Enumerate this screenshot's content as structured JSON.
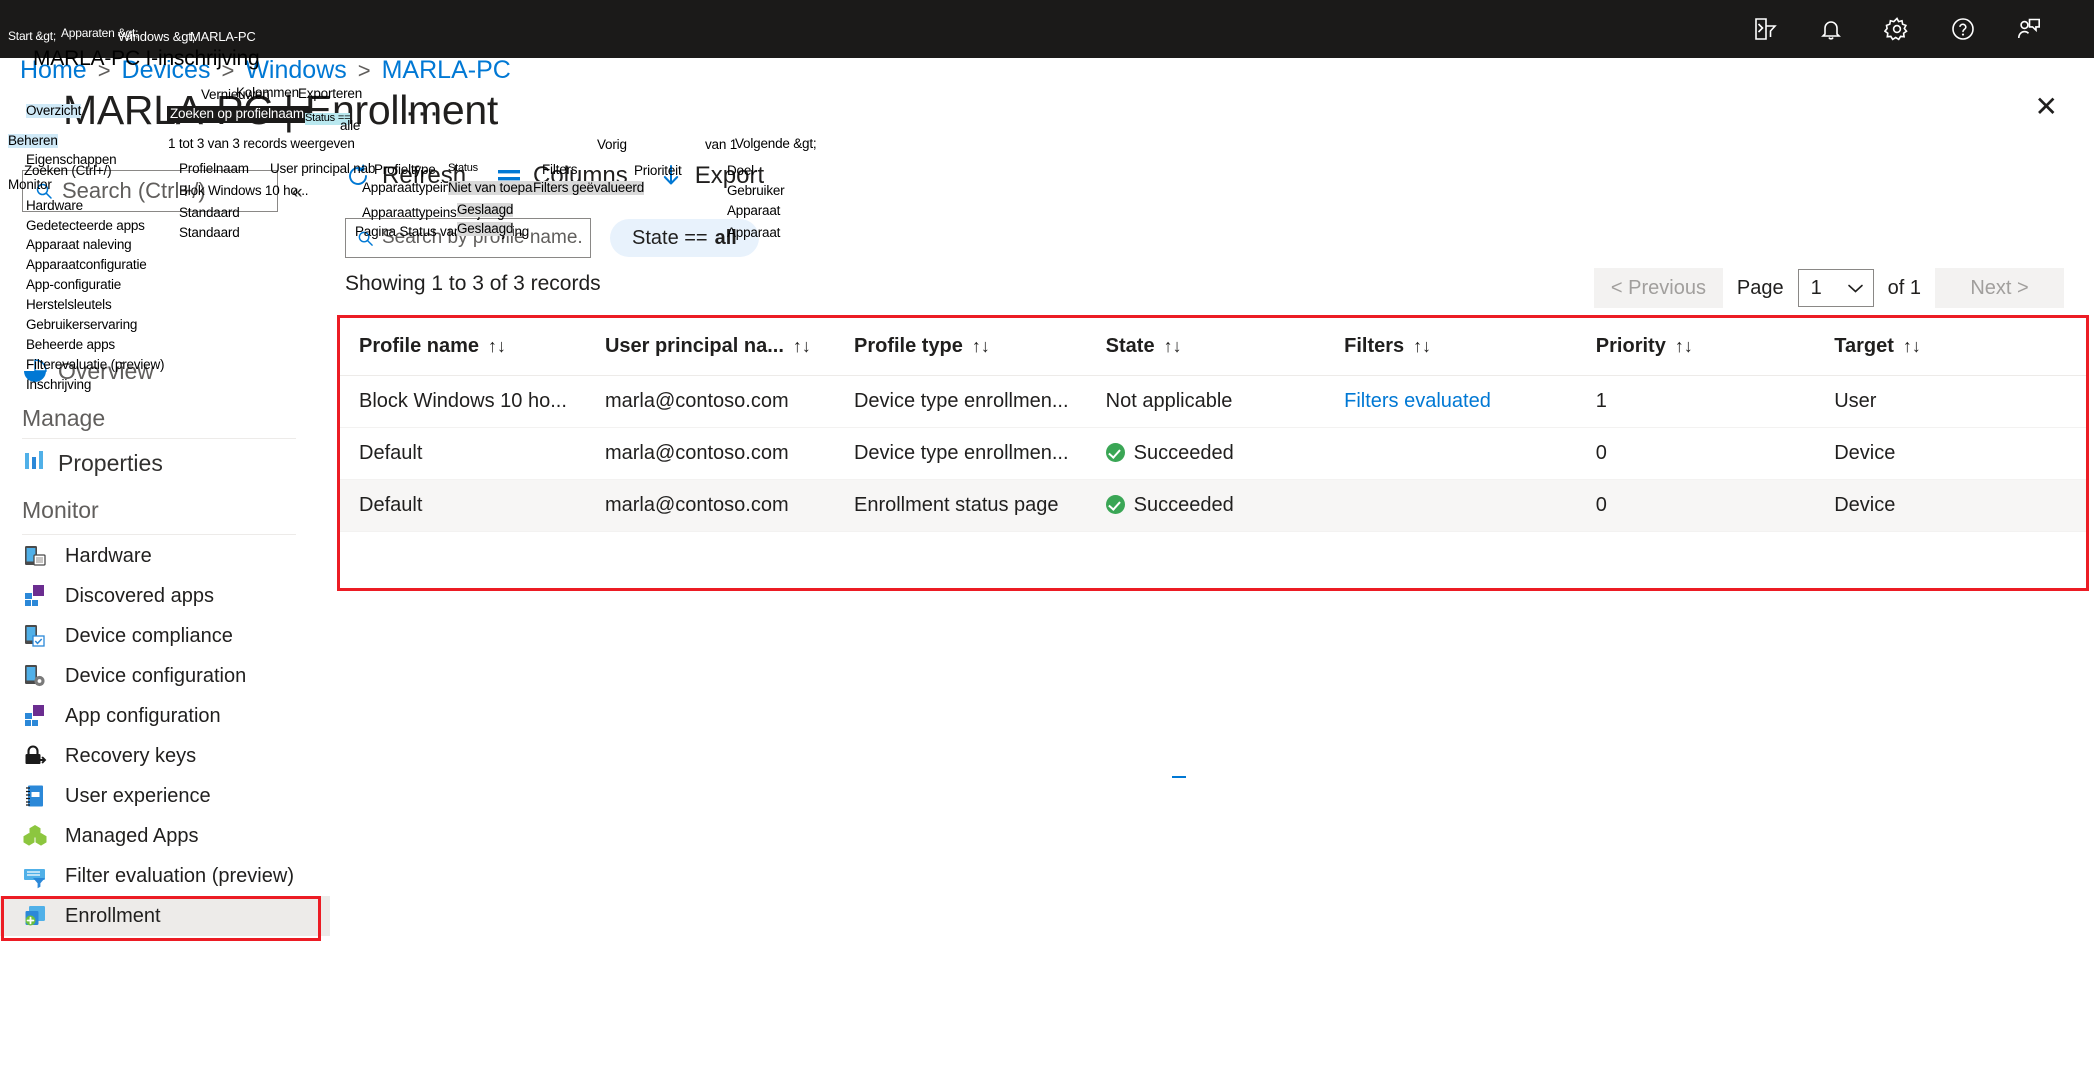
{
  "topbar": {
    "icons": [
      {
        "name": "cloud-shell-icon",
        "title": "Cloud Shell"
      },
      {
        "name": "notifications-bell-icon",
        "title": "Notifications"
      },
      {
        "name": "settings-gear-icon",
        "title": "Settings"
      },
      {
        "name": "help-question-icon",
        "title": "Help"
      },
      {
        "name": "feedback-person-icon",
        "title": "Feedback"
      }
    ]
  },
  "breadcrumb": {
    "items": [
      "Home",
      "Devices",
      "Windows",
      "MARLA-PC"
    ],
    "separator": ">"
  },
  "header": {
    "title": "MARLA-PC | Enrollment",
    "ellipsis": "···",
    "close": "✕"
  },
  "sidebar": {
    "search_placeholder": "Search (Ctrl+/)",
    "collapse_glyph": "«",
    "section_overview": "Overview",
    "section_manage": "Manage",
    "section_monitor": "Monitor",
    "properties_label": "Properties",
    "items": [
      {
        "label": "Hardware",
        "icon": "device-hardware-icon"
      },
      {
        "label": "Discovered apps",
        "icon": "apps-grid-icon"
      },
      {
        "label": "Device compliance",
        "icon": "device-check-icon"
      },
      {
        "label": "Device configuration",
        "icon": "device-gear-icon"
      },
      {
        "label": "App configuration",
        "icon": "apps-grid-icon"
      },
      {
        "label": "Recovery keys",
        "icon": "lock-key-icon"
      },
      {
        "label": "User experience",
        "icon": "notebook-icon"
      },
      {
        "label": "Managed Apps",
        "icon": "cubes-icon"
      },
      {
        "label": "Filter evaluation (preview)",
        "icon": "filter-list-icon"
      },
      {
        "label": "Enrollment",
        "icon": "device-add-icon",
        "selected": true
      }
    ]
  },
  "toolbar": {
    "refresh_label": "Refresh",
    "columns_label": "Columns",
    "export_label": "Export"
  },
  "filters": {
    "search_placeholder": "Search by profile name.",
    "state_pill_key": "State  ==",
    "state_pill_value": "all"
  },
  "records_text": "Showing 1 to 3 of 3 records",
  "pagination": {
    "previous_label": "< Previous",
    "page_label": "Page",
    "page_value": "1",
    "of_label": "of 1",
    "next_label": "Next >",
    "chevron": "⌄"
  },
  "table": {
    "columns": [
      {
        "key": "profile_name",
        "label": "Profile name"
      },
      {
        "key": "user_principal_name",
        "label": "User principal na..."
      },
      {
        "key": "profile_type",
        "label": "Profile type"
      },
      {
        "key": "state",
        "label": "State"
      },
      {
        "key": "filters",
        "label": "Filters"
      },
      {
        "key": "priority",
        "label": "Priority"
      },
      {
        "key": "target",
        "label": "Target"
      }
    ],
    "sort_glyph": "↑↓",
    "rows": [
      {
        "profile_name": "Block Windows 10 ho...",
        "user_principal_name": "marla@contoso.com",
        "profile_type": "Device type enrollmen...",
        "state": "Not applicable",
        "state_ok": false,
        "filters": "Filters evaluated",
        "filters_is_link": true,
        "priority": "1",
        "target": "User"
      },
      {
        "profile_name": "Default",
        "user_principal_name": "marla@contoso.com",
        "profile_type": "Device type enrollmen...",
        "state": "Succeeded",
        "state_ok": true,
        "filters": "",
        "filters_is_link": false,
        "priority": "0",
        "target": "Device"
      },
      {
        "profile_name": "Default",
        "user_principal_name": "marla@contoso.com",
        "profile_type": "Enrollment status page",
        "state": "Succeeded",
        "state_ok": true,
        "filters": "",
        "filters_is_link": false,
        "priority": "0",
        "target": "Device"
      }
    ]
  },
  "annotations": {
    "breadcrumb_start": "Start &gt;",
    "breadcrumb_devices": "Apparaten &gt;",
    "breadcrumb_windows": "Windows &gt;",
    "breadcrumb_device": "MARLA-PC",
    "page_title_nl": "MARLA-PC I-inschrijving",
    "nav_search_nl": "Zoeken (Ctrl+/)",
    "overview_nl": "Overzicht",
    "manage_nl": "Beheren",
    "properties_nl": "Eigenschappen",
    "monitor_nl": "Monitor",
    "hardware_nl": "Hardware",
    "discovered_apps_nl": "Gedetecteerde apps",
    "device_compliance_nl": "Apparaat naleving",
    "device_configuration_nl": "Apparaatconfiguratie",
    "app_configuration_nl": "App-configuratie",
    "recovery_keys_nl": "Herstelsleutels",
    "user_experience_nl": "Gebruikerservaring",
    "managed_apps_nl": "Beheerde apps",
    "filter_evaluation_nl": "Filterevaluatie (preview)",
    "enrollment_nl": "Inschrijving",
    "refresh_nl": "Vernieuwen",
    "columns_nl": "Kolommen",
    "export_nl": "Exporteren",
    "search_profile_nl": "Zoeken op profielnaam.",
    "state_key_nl": "Status ==",
    "state_value_nl": "alle",
    "records_nl": "1 tot 3 van 3 records weergeven",
    "col_profile_name_nl": "Profielnaam",
    "col_upn_nl": "User principal nab",
    "col_profile_type_nl": "Profieltype",
    "col_state_nl": "Status",
    "col_filters_nl": "Filters",
    "col_priority_nl": "Prioriteit",
    "col_target_nl": "Doel",
    "row1_profile_nl": "Blok Windows 10 ho...",
    "row2_profile_nl": "Standaard",
    "row3_profile_nl": "Standaard",
    "row1_type_nl": "Apparaattypeinschrijving",
    "row2_type_nl": "Apparaattypeinschrijving",
    "row3_type_nl": "Pagina Status van inschrijving",
    "row1_state_nl": "Niet van toepassing",
    "row2_state_nl": "Geslaagd",
    "row3_state_nl": "Geslaagd",
    "row1_filters_nl": "Filters geëvalueerd",
    "row1_target_nl": "Gebruiker",
    "row2_target_nl": "Apparaat",
    "row3_target_nl": "Apparaat",
    "prev_nl": "Vorig",
    "of_nl": "van 1",
    "next_nl": "Volgende &gt;"
  },
  "colors": {
    "accent": "#0078d4",
    "topbar": "#1b1a19",
    "highlight_box": "#ec1c24",
    "success": "#3aa655"
  }
}
